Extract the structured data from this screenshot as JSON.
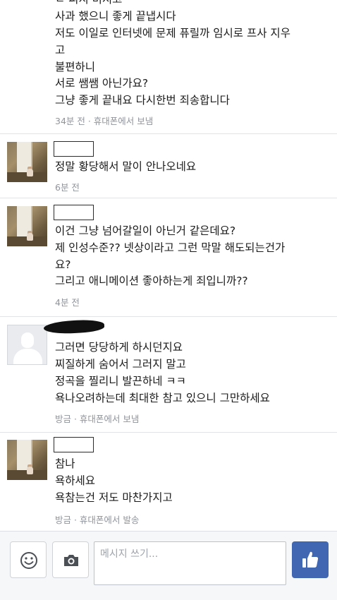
{
  "messages": [
    {
      "lines": [
        "ㄴ 피지 미지고",
        "사과 했으니 좋게 끝냅시다",
        "저도 이일로 인터넷에 문제 퓨릴까 임시로 프사 지우",
        "고",
        "불편하니",
        "서로 쌤쌤 아닌가요?",
        "그냥 좋게 끝내요 다시한번 죄송합니다"
      ],
      "meta": "34분 전 · 휴대폰에서 보냄"
    },
    {
      "lines": [
        "정말 황당해서 말이 안나오네요"
      ],
      "meta": "6분 전"
    },
    {
      "lines": [
        "이건 그냥 넘어갈일이 아닌거 같은데요?",
        "제 인성수준?? 넷상이라고 그런 막말 해도되는건가",
        "요?",
        "그리고 애니메이션 좋아하는게 죄입니까??"
      ],
      "meta": "4분 전"
    },
    {
      "lines": [
        "그러면 당당하게 하시던지요",
        "찌질하게 숨어서 그러지 말고",
        "정곡을 찔리니 발끈하네 ㅋㅋ",
        "욕나오려하는데 최대한 참고 있으니 그만하세요"
      ],
      "meta": "방금 · 휴대폰에서 보냄"
    },
    {
      "lines": [
        "참나",
        "욕하세요",
        "욕참는건 저도 마찬가지고"
      ],
      "meta": "방금 · 휴대폰에서 발송"
    }
  ],
  "composer": {
    "placeholder": "메시지 쓰기...",
    "icons": [
      "emoji-icon",
      "camera-icon",
      "thumbs-up-icon"
    ],
    "like_color": "#4267b2"
  }
}
